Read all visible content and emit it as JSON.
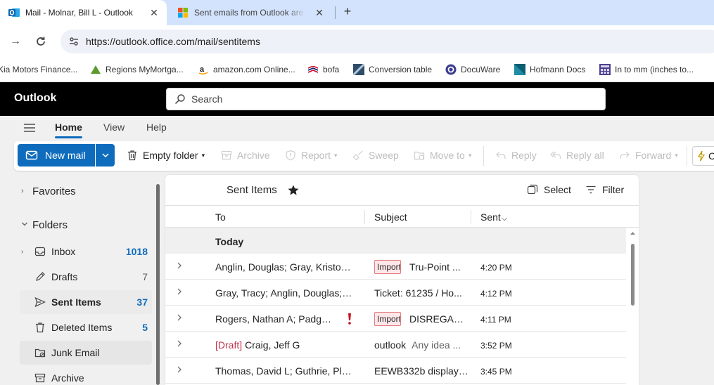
{
  "browser": {
    "tabs": [
      {
        "title": "Mail - Molnar, Bill L - Outlook",
        "active": true,
        "icon": "outlook-icon"
      },
      {
        "title": "Sent emails from Outlook are ra",
        "active": false,
        "icon": "microsoft-icon"
      }
    ],
    "close_glyph": "✕",
    "new_tab_glyph": "+",
    "back_glyph": "→",
    "reload_glyph": "↻",
    "url": "https://outlook.office.com/mail/sentitems",
    "bookmarks": [
      {
        "label": "Kia Motors Finance...",
        "icon": "kia-icon"
      },
      {
        "label": "Regions MyMortga...",
        "icon": "regions-icon"
      },
      {
        "label": "amazon.com Online...",
        "icon": "amazon-icon"
      },
      {
        "label": "bofa",
        "icon": "bofa-icon"
      },
      {
        "label": "Conversion table",
        "icon": "conversion-icon"
      },
      {
        "label": "DocuWare",
        "icon": "docuware-icon"
      },
      {
        "label": "Hofmann Docs",
        "icon": "hofmann-icon"
      },
      {
        "label": "In to mm (inches to...",
        "icon": "calculator-icon"
      }
    ]
  },
  "outlook": {
    "brand": "Outlook",
    "search_placeholder": "Search",
    "ribbon_tabs": [
      "Home",
      "View",
      "Help"
    ],
    "commands": {
      "new_mail": "New mail",
      "empty_folder": "Empty folder",
      "archive": "Archive",
      "report": "Report",
      "sweep": "Sweep",
      "move_to": "Move to",
      "reply": "Reply",
      "reply_all": "Reply all",
      "forward": "Forward",
      "copilot_initial": "C"
    },
    "dropdown_glyph": "▾",
    "expand_glyph": "›",
    "accent": "#0f6cbd"
  },
  "folders": {
    "favorites_label": "Favorites",
    "folders_label": "Folders",
    "items": [
      {
        "name": "Inbox",
        "count": "1018",
        "icon": "inbox-icon"
      },
      {
        "name": "Drafts",
        "count": "7",
        "icon": "drafts-icon"
      },
      {
        "name": "Sent Items",
        "count": "37",
        "icon": "send-icon",
        "selected": true
      },
      {
        "name": "Deleted Items",
        "count": "5",
        "icon": "trash-icon"
      },
      {
        "name": "Junk Email",
        "count": "",
        "icon": "junk-icon"
      },
      {
        "name": "Archive",
        "count": "",
        "icon": "archive-icon"
      }
    ]
  },
  "message_list": {
    "title": "Sent Items",
    "select_label": "Select",
    "filter_label": "Filter",
    "columns": {
      "to": "To",
      "subject": "Subject",
      "sent": "Sent"
    },
    "sort_glyph": "⌵",
    "group": "Today",
    "rows": [
      {
        "to": "Anglin, Douglas; Gray, Kristop...",
        "draft": "",
        "tag": "Important",
        "subject": "Tru-Point ...",
        "preview": "",
        "time": "4:20 PM",
        "important": false
      },
      {
        "to": "Gray, Tracy; Anglin, Douglas; J...",
        "draft": "",
        "tag": "",
        "subject": "Ticket: 61235 / Ho...",
        "preview": "",
        "time": "4:12 PM",
        "important": false
      },
      {
        "to": "Rogers, Nathan A; Padge...",
        "draft": "",
        "tag": "Important",
        "subject": "DISREGAR...",
        "preview": "",
        "time": "4:11 PM",
        "important": true
      },
      {
        "to": "Craig, Jeff G",
        "draft": "[Draft]",
        "tag": "",
        "subject": "outlook",
        "preview": "Any idea ...",
        "time": "3:52 PM",
        "important": false
      },
      {
        "to": "Thomas, David L; Guthrie, Ples ...",
        "draft": "",
        "tag": "",
        "subject": "EEWB332b display ...",
        "preview": "",
        "time": "3:45 PM",
        "important": false
      }
    ]
  }
}
